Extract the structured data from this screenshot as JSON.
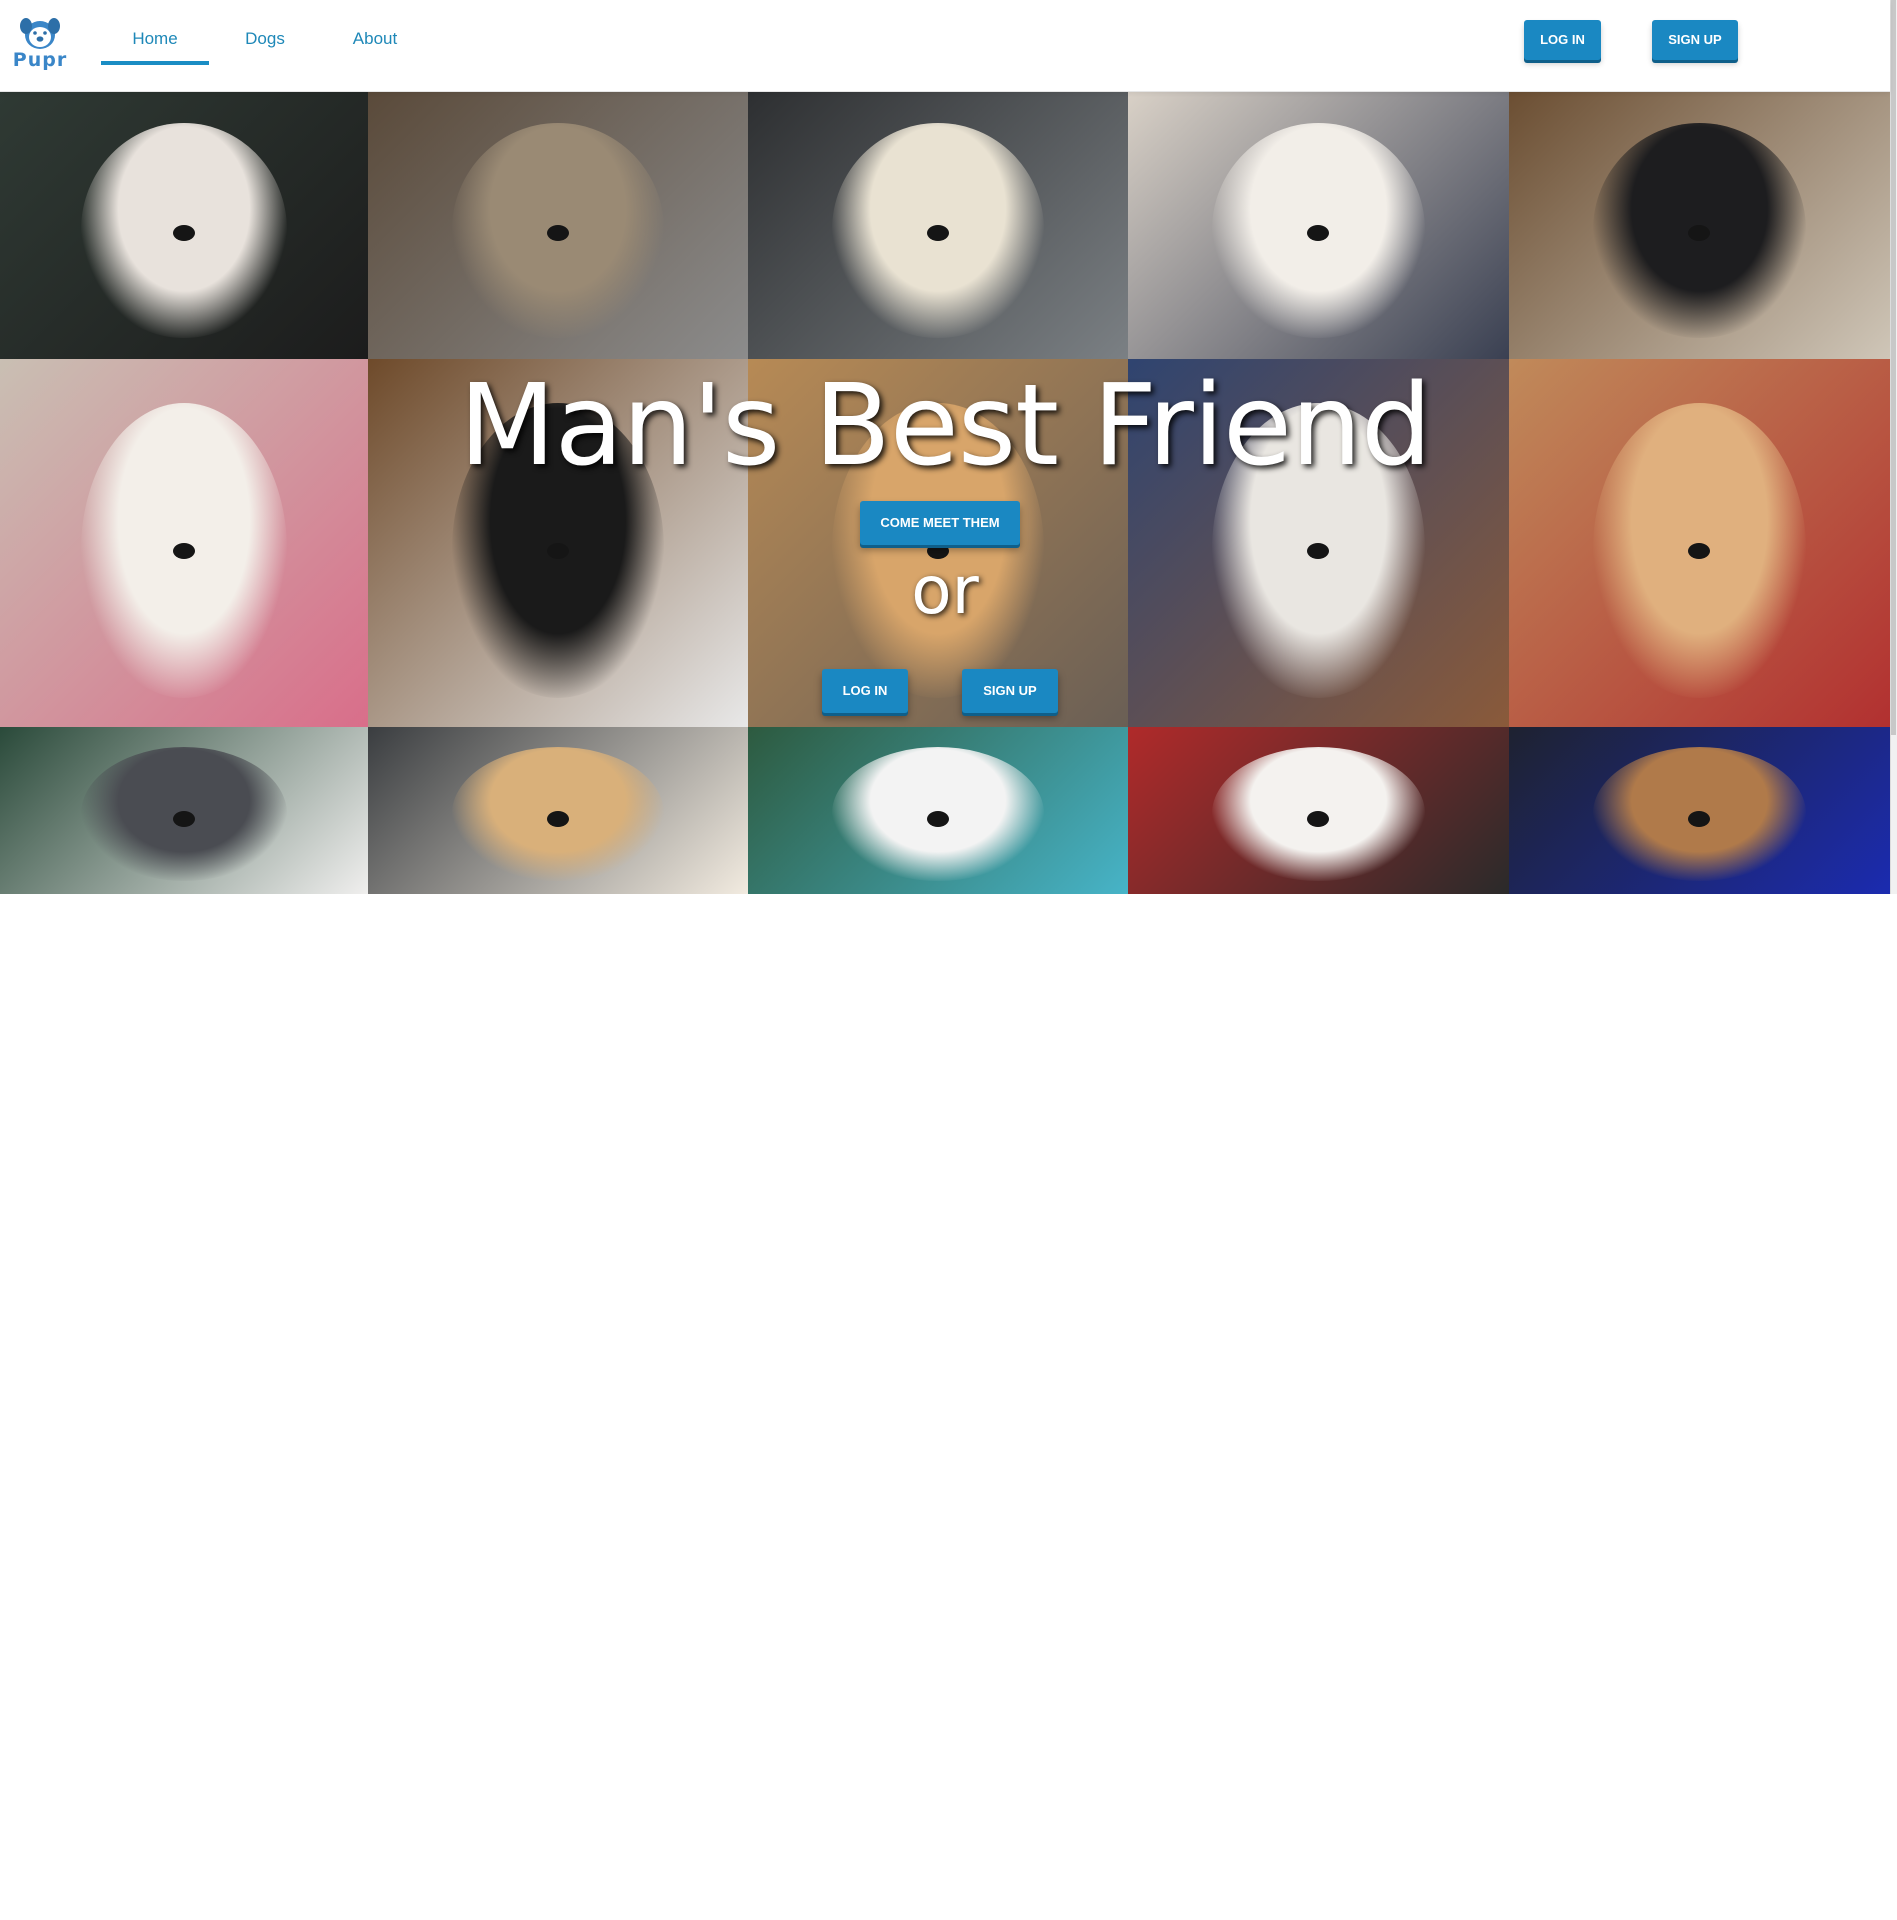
{
  "brand": {
    "name": "Pupr",
    "icon": "dog-face-icon",
    "color": "#3a86c8"
  },
  "nav": {
    "links": [
      {
        "label": "Home",
        "active": true
      },
      {
        "label": "Dogs",
        "active": false
      },
      {
        "label": "About",
        "active": false
      }
    ],
    "login_label": "LOG IN",
    "signup_label": "SIGN UP"
  },
  "hero": {
    "title": "Man's Best Friend",
    "cta_label": "COME MEET THEM",
    "or_text": "or",
    "login_label": "LOG IN",
    "signup_label": "SIGN UP",
    "photo_grid": {
      "rows": 3,
      "columns": 5,
      "tile_palettes": [
        [
          "#2f3a34",
          "#e8e2dc",
          "#1c1c1c"
        ],
        [
          "#5a4a3a",
          "#9a8a74",
          "#8c8c8c"
        ],
        [
          "#2d2f31",
          "#e9e2d2",
          "#7b8084"
        ],
        [
          "#d9d1c7",
          "#f2eee8",
          "#3a4052"
        ],
        [
          "#6b4e32",
          "#1d1d1f",
          "#cfc6b8"
        ],
        [
          "#c9bfb3",
          "#f3efe9",
          "#d96e8a"
        ],
        [
          "#6e4a2a",
          "#1a1a1a",
          "#e8e8e8"
        ],
        [
          "#b78a55",
          "#d8a56a",
          "#6a5f55"
        ],
        [
          "#2f4470",
          "#e9e6e1",
          "#8a5a3a"
        ],
        [
          "#c08a5a",
          "#e0b07e",
          "#b23030"
        ],
        [
          "#2a4a3a",
          "#4a4c52",
          "#f0efee"
        ],
        [
          "#3a3d40",
          "#d9b07a",
          "#f2ebe0"
        ],
        [
          "#2d5a3f",
          "#f3f3f3",
          "#47b4c8"
        ],
        [
          "#b02a2a",
          "#f4f2ef",
          "#2a2a2a"
        ],
        [
          "#1e2230",
          "#b07a4a",
          "#1b2bb0"
        ]
      ]
    }
  },
  "accent_color": "#1a88c2"
}
